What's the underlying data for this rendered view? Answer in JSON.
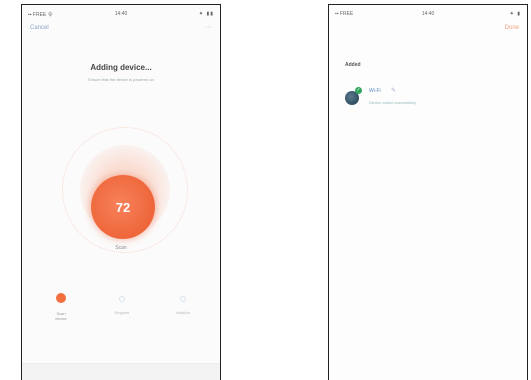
{
  "left_screen": {
    "status_bar": {
      "signal": "▪▪ FREE 令",
      "time": "14:40",
      "battery": "⁕ ▮▮"
    },
    "cancel_label": "Cancel",
    "menu_icon": "more-icon",
    "title": "Adding device...",
    "subtitle": "Ensure that the device is powered on",
    "countdown": "72",
    "mode_label": "Scan",
    "steps": [
      {
        "label": "Scan\ndevice",
        "active": true
      },
      {
        "label": "Register",
        "active": false
      },
      {
        "label": "Initialize",
        "active": false
      }
    ],
    "colors": {
      "accent": "#ea5a2c",
      "accent_light": "#f7815a",
      "link": "#8aa4c8"
    }
  },
  "right_screen": {
    "status_bar": {
      "signal": "▪▪ FREE",
      "time": "14:40",
      "battery": "⁕ ▮"
    },
    "action_label": "Done",
    "section_header": "Added",
    "device": {
      "name": "Wi-Fi",
      "status": "Device added successfully",
      "icon": "device-icon",
      "badge": "✓"
    },
    "colors": {
      "badge": "#2fa65c",
      "device_name": "#5d8ac2",
      "action": "#f3a07d"
    }
  }
}
